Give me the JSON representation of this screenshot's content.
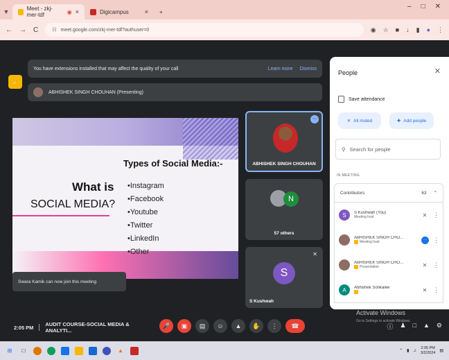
{
  "browser": {
    "tabs": [
      {
        "label": "Meet - zkj-mer-tdf",
        "active": true,
        "close": "×"
      },
      {
        "label": "Digicampus",
        "active": false,
        "close": "×"
      }
    ],
    "new_tab": "+",
    "window_controls": {
      "minimize": "–",
      "maximize": "□",
      "close": "✕"
    },
    "nav": {
      "back": "←",
      "forward": "→",
      "reload": "C"
    },
    "url": "meet.google.com/zkj-mer-tdf?authuser=0"
  },
  "meet": {
    "extension_banner": {
      "text": "You have extensions installed that may affect the quality of your call",
      "learn_more": "Learn more",
      "dismiss": "Dismiss"
    },
    "presenting_banner": "ABHISHEK SINGH CHOUHAN (Presenting)",
    "slide": {
      "heading": "Types of Social Media:-",
      "title_line1": "What is",
      "title_line2": "SOCIAL MEDIA?",
      "items": [
        "Instagram",
        "Facebook",
        "Youtube",
        "Twitter",
        "LinkedIn",
        "Other"
      ]
    },
    "notice": "Swara Kamik can now join this meeting",
    "tiles": {
      "presenter_name": "ABHISHEK SINGH CHOUHAN",
      "others_label": "57 others",
      "others_avatar": "N",
      "self_name": "S Kushwah",
      "self_avatar": "S"
    },
    "bottom": {
      "time": "2:05 PM",
      "meeting_title": "AUDIT COURSE-SOCIAL MEDIA & ANALYTI..."
    }
  },
  "people_panel": {
    "title": "People",
    "save_attendance": "Save attendance",
    "mute_all": "All muted",
    "add_people": "Add people",
    "search_placeholder": "Search for people",
    "section": "IN MEETING",
    "contributors_label": "Contributors",
    "contributors_count": "63",
    "people": [
      {
        "name": "S Kushwah (You)",
        "role": "Meeting host",
        "avatar": "S",
        "color": "#7e57c2"
      },
      {
        "name": "ABHISHEK SINGH CHO...",
        "role": "Meeting host",
        "avatar": "",
        "color": "#8d6e63"
      },
      {
        "name": "ABHISHEK SINGH CHO...",
        "role": "Presentation",
        "avatar": "",
        "color": "#8d6e63"
      },
      {
        "name": "Abhishek Sonkalee",
        "role": "",
        "avatar": "A",
        "color": "#00897b"
      }
    ]
  },
  "watermark": {
    "line1": "Activate Windows",
    "line2": "Go to Settings to activate Windows."
  },
  "taskbar": {
    "time": "2:05 PM",
    "date": "3/2/2024"
  },
  "colors": {
    "accent": "#1a73e8",
    "end_call": "#ea4335",
    "dark_bg": "#202124"
  }
}
